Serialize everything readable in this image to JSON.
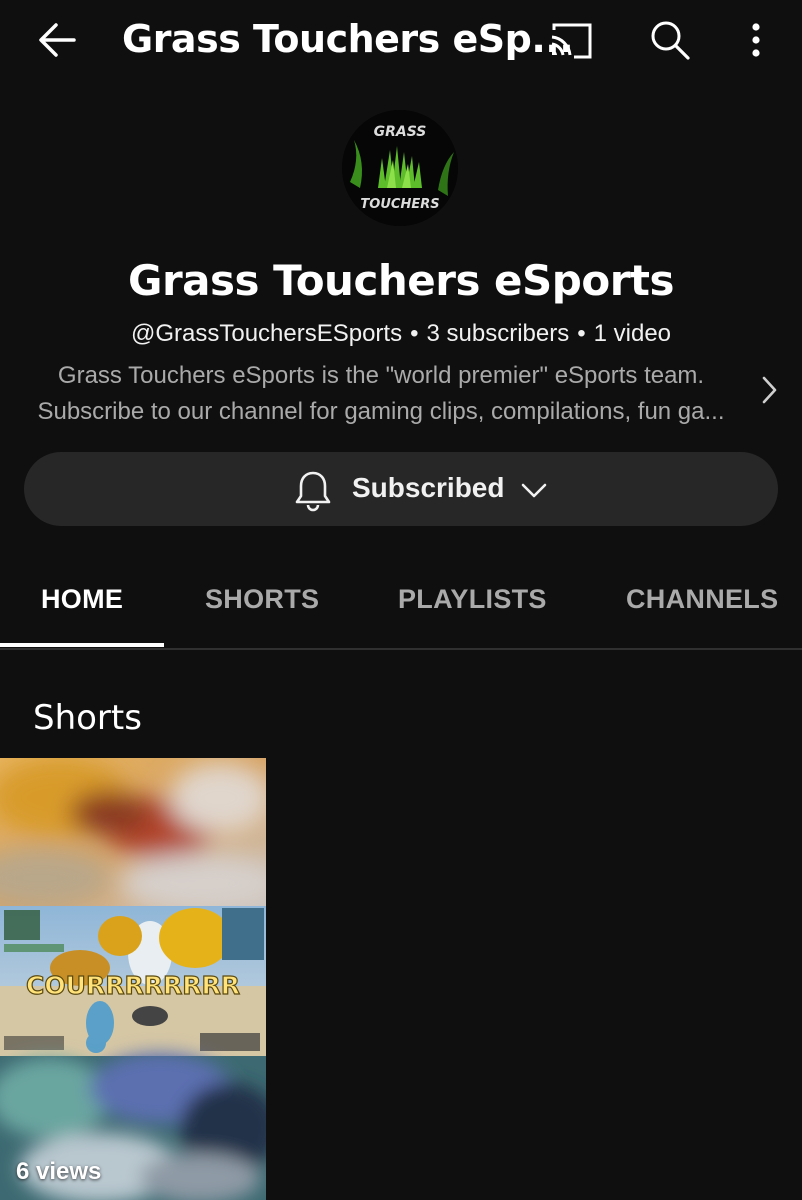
{
  "header": {
    "title": "Grass Touchers eSp...",
    "back_icon": "arrow-left-icon",
    "cast_icon": "cast-icon",
    "search_icon": "search-icon",
    "more_icon": "more-vertical-icon"
  },
  "channel": {
    "avatar_text_top": "GRASS",
    "avatar_text_bottom": "TOUCHERS",
    "name": "Grass Touchers eSports",
    "handle": "@GrassTouchersESports",
    "subscribers": "3 subscribers",
    "videos": "1 video",
    "description_line1": "Grass Touchers eSports is the \"world premier\" eSports team.",
    "description_line2": "Subscribe to our channel for gaming clips, compilations, fun ga..."
  },
  "subscribe": {
    "label": "Subscribed",
    "bell_icon": "bell-icon",
    "chevron_icon": "chevron-down-icon"
  },
  "tabs": [
    {
      "label": "HOME",
      "active": true
    },
    {
      "label": "SHORTS",
      "active": false
    },
    {
      "label": "PLAYLISTS",
      "active": false
    },
    {
      "label": "CHANNELS",
      "active": false
    }
  ],
  "shorts_section": {
    "title": "Shorts",
    "items": [
      {
        "overlay_text": "COURRRRRRRR",
        "views": "6 views"
      }
    ]
  },
  "colors": {
    "background": "#0f0f0f",
    "button_bg": "#272727",
    "secondary_text": "#aaaaaa",
    "accent_green": "#4caf2a"
  }
}
